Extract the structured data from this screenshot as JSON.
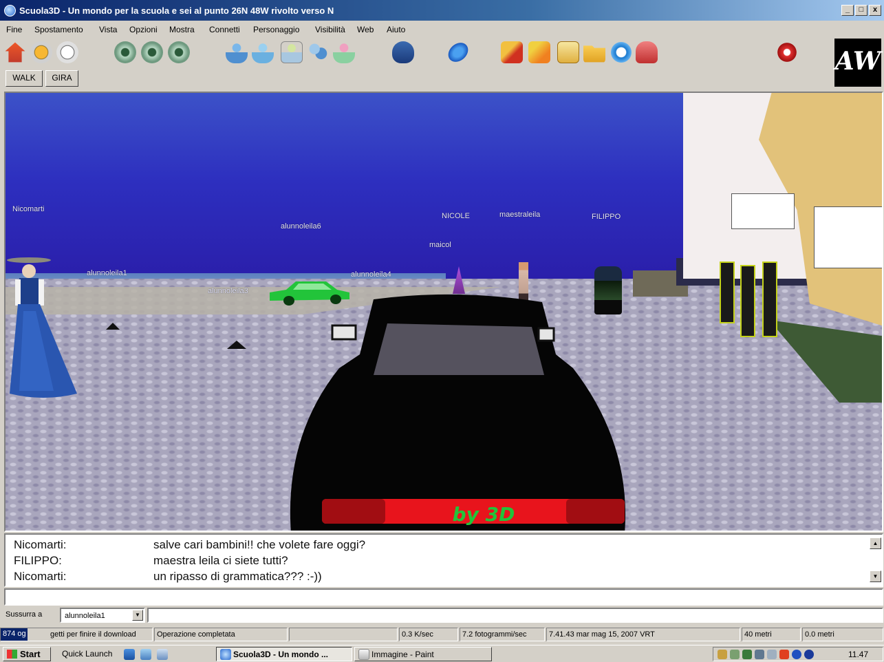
{
  "window": {
    "title": "Scuola3D - Un mondo per la scuola e sei al punto 26N 48W rivolto verso N",
    "min_label": "_",
    "max_label": "□",
    "close_label": "x"
  },
  "menu": [
    "Fine",
    "Spostamento",
    "Vista",
    "Opzioni",
    "Mostra",
    "Connetti",
    "Personaggio",
    "Visibilità",
    "Web",
    "Aiuto"
  ],
  "toolbar": {
    "icons": [
      "home-icon",
      "back-icon",
      "forward-icon",
      "eye-icon",
      "eye-icon",
      "eye-icon",
      "avatar-icon",
      "avatar-icon",
      "avatar-icon",
      "group-icon",
      "teleport-icon",
      "chat-icon",
      "globe-icon",
      "pencil-icon",
      "paint-icon",
      "notes-icon",
      "folder-icon",
      "refresh-icon",
      "toy-icon",
      "close-icon"
    ],
    "logo_text": "AW",
    "walk_label": "WALK",
    "gira_label": "GIRA"
  },
  "scene": {
    "names": [
      "Nicomarti",
      "alunnoleila6",
      "NICOLE",
      "maestraleila",
      "FILIPPO",
      "maicol",
      "alunnoleila1",
      "alunnoleila4",
      "alunnoleila3"
    ],
    "car_plate": "by 3D",
    "colors": {
      "sky": "#2d2fbf",
      "ground": "#a9a6bd",
      "green_car": "#22c43a",
      "black_car": "#050505",
      "tail_light": "#e8141c"
    }
  },
  "chat": {
    "lines": [
      {
        "who": "Nicomarti:",
        "msg": "salve cari bambini!! che volete fare oggi?"
      },
      {
        "who": "FILIPPO:",
        "msg": "maestra leila ci siete tutti?"
      },
      {
        "who": "Nicomarti:",
        "msg": "un ripasso di grammatica??? :-))"
      }
    ],
    "input_value": ""
  },
  "whisper": {
    "label": "Sussurra a",
    "selected": "alunnoleila1",
    "input_value": ""
  },
  "status": {
    "download_highlight": "874 og",
    "download_text": "getti per finire il download",
    "operation": "Operazione completata",
    "blank": "",
    "speed": "0.3 K/sec",
    "fps": "7.2 fotogrammi/sec",
    "datetime": "7.41.43 mar mag 15, 2007 VRT",
    "distance1": "40 metri",
    "distance2": "0.0 metri"
  },
  "taskbar": {
    "start": "Start",
    "quicklaunch": "Quick Launch",
    "tasks": [
      {
        "label": "Scuola3D - Un mondo ...",
        "active": true
      },
      {
        "label": "Immagine - Paint",
        "active": false
      }
    ],
    "clock": "11.47"
  }
}
